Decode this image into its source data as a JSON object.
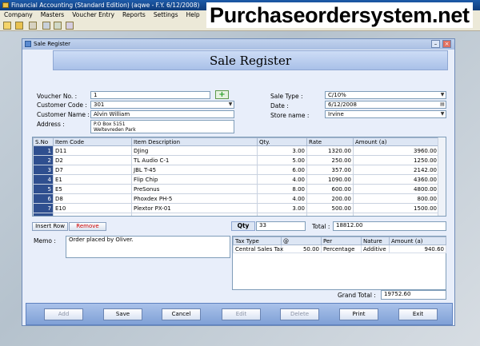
{
  "app": {
    "title": "Financial Accounting (Standard Edition) (aqwe - F.Y. 6/12/2008)",
    "watermark": "Purchaseordersystem.net",
    "menu": [
      "Company",
      "Masters",
      "Voucher Entry",
      "Reports",
      "Settings",
      "Help"
    ]
  },
  "form": {
    "window_title": "Sale Register",
    "heading": "Sale Register",
    "fields": {
      "voucher_no_label": "Voucher No. :",
      "voucher_no": "1",
      "customer_code_label": "Customer Code :",
      "customer_code": "301",
      "customer_name_label": "Customer Name :",
      "customer_name": "Alvin William",
      "address_label": "Address :",
      "address_line1": "P.O Box 5151",
      "address_line2": "Weltevreden Park",
      "sale_type_label": "Sale Type :",
      "sale_type": "C/10%",
      "date_label": "Date :",
      "date": "6/12/2008",
      "store_name_label": "Store name :",
      "store_name": "Irvine"
    },
    "items_table": {
      "columns": [
        "S.No",
        "Item Code",
        "Item Description",
        "Qty.",
        "Rate",
        "Amount (a)"
      ],
      "rows": [
        {
          "sno": "1",
          "code": "D11",
          "desc": "DJing",
          "qty": "3.00",
          "rate": "1320.00",
          "amount": "3960.00"
        },
        {
          "sno": "2",
          "code": "D2",
          "desc": "TL Audio C-1",
          "qty": "5.00",
          "rate": "250.00",
          "amount": "1250.00"
        },
        {
          "sno": "3",
          "code": "D7",
          "desc": "JBL T-45",
          "qty": "6.00",
          "rate": "357.00",
          "amount": "2142.00"
        },
        {
          "sno": "4",
          "code": "E1",
          "desc": "Flip Chip",
          "qty": "4.00",
          "rate": "1090.00",
          "amount": "4360.00"
        },
        {
          "sno": "5",
          "code": "E5",
          "desc": "PreSonus",
          "qty": "8.00",
          "rate": "600.00",
          "amount": "4800.00"
        },
        {
          "sno": "6",
          "code": "D8",
          "desc": "Phoxdex PH-5",
          "qty": "4.00",
          "rate": "200.00",
          "amount": "800.00"
        },
        {
          "sno": "7",
          "code": "E10",
          "desc": "Plextor PX-01",
          "qty": "3.00",
          "rate": "500.00",
          "amount": "1500.00"
        }
      ]
    },
    "insert_row_label": "Insert Row",
    "remove_label": "Remove",
    "qty_label": "Qty",
    "qty_total": "33",
    "total_label": "Total :",
    "total_value": "18812.00",
    "memo_label": "Memo :",
    "memo": "Order placed by Oliver.",
    "tax_table": {
      "columns": [
        "Tax Type",
        "@",
        "Per",
        "Nature",
        "Amount (a)"
      ],
      "rows": [
        {
          "type": "Central Sales Tax",
          "at": "50.00",
          "per": "Percentage",
          "nature": "Additive",
          "amount": "940.60"
        }
      ]
    },
    "grand_total_label": "Grand Total :",
    "grand_total": "19752.60",
    "buttons": {
      "add": "Add",
      "save": "Save",
      "cancel": "Cancel",
      "edit": "Edit",
      "delete": "Delete",
      "print": "Print",
      "exit": "Exit"
    }
  },
  "colors": {
    "accent": "#2f4f8f",
    "remove_text": "#cc0000",
    "add_green": "#2aa02a"
  }
}
